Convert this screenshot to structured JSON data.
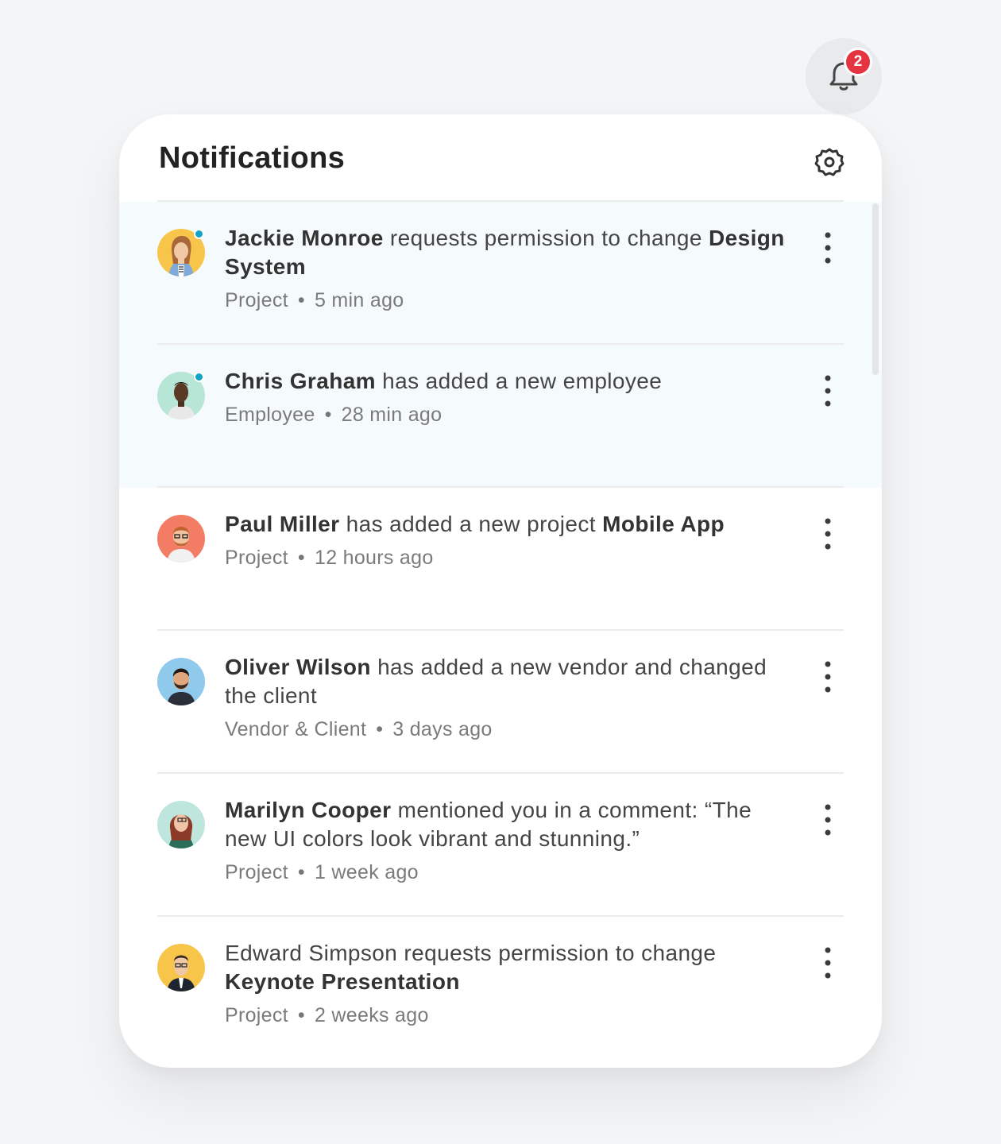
{
  "header": {
    "title": "Notifications",
    "settings_icon": "gear-icon",
    "bell_icon": "bell-icon",
    "badge_count": "2"
  },
  "colors": {
    "unread_bg": "#f5fbfc",
    "unread_dot": "#12a4c7",
    "badge": "#e5333f"
  },
  "notifications": [
    {
      "user": "Jackie Monroe",
      "action": " requests permission to change ",
      "target": "Design System",
      "category": "Project",
      "time": "5 min ago",
      "unread": true
    },
    {
      "user": "Chris Graham",
      "action": " has added a new employee",
      "target": "",
      "category": "Employee",
      "time": "28 min ago",
      "unread": true
    },
    {
      "user": "Paul Miller",
      "action": " has added a new project ",
      "target": "Mobile App",
      "category": "Project",
      "time": "12 hours ago",
      "unread": false
    },
    {
      "user": "Oliver Wilson",
      "action": " has added a new vendor and changed the client",
      "target": "",
      "category": "Vendor & Client",
      "time": "3 days ago",
      "unread": false
    },
    {
      "user": "Marilyn Cooper",
      "action": " mentioned you in a comment: “The new UI colors look vibrant and stunning.”",
      "target": "",
      "category": "Project",
      "time": "1 week ago",
      "unread": false
    },
    {
      "user": "",
      "lead": "Edward Simpson requests permission to change ",
      "target": "Keynote Presentation",
      "category": "Project",
      "time": "2 weeks ago",
      "unread": false
    }
  ],
  "separator": "•"
}
